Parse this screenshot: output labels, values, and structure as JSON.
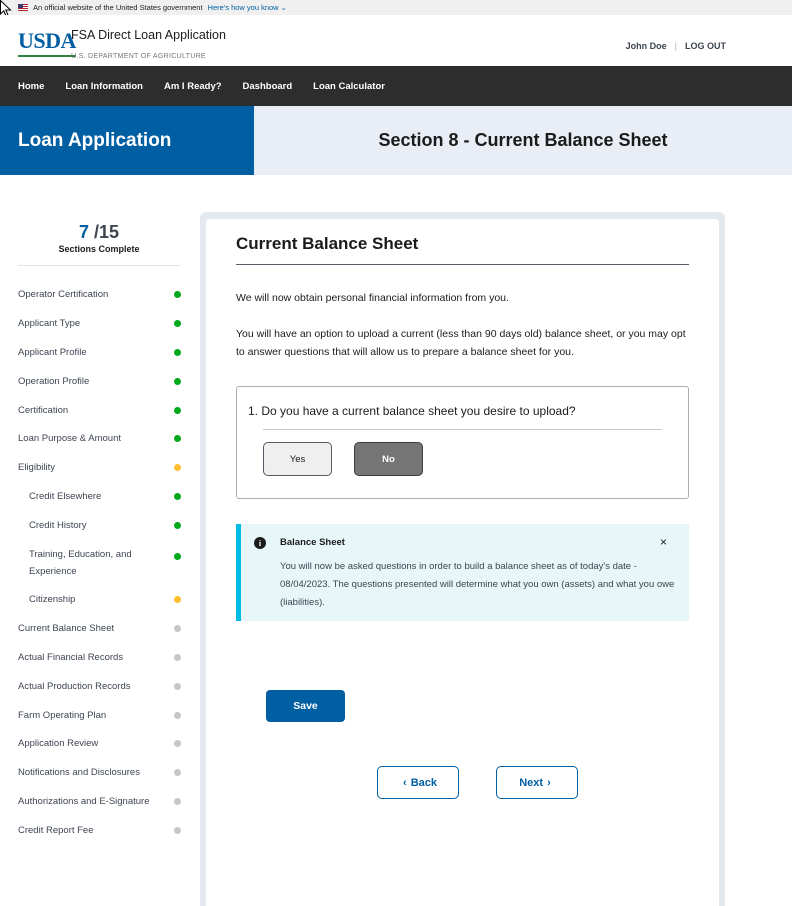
{
  "gov_banner": {
    "text": "An official website of the United States government",
    "link": "Here's how you know ⌄"
  },
  "header": {
    "logo": "USDA",
    "app_title": "FSA Direct Loan Application",
    "department": "U.S. DEPARTMENT OF AGRICULTURE",
    "user_name": "John Doe",
    "separator": "|",
    "logout": "LOG OUT"
  },
  "nav": [
    "Home",
    "Loan Information",
    "Am I Ready?",
    "Dashboard",
    "Loan Calculator"
  ],
  "hero": {
    "left_title": "Loan Application",
    "section_title": "Section 8 - Current Balance Sheet"
  },
  "progress": {
    "completed": "7",
    "total": "/15",
    "label": "Sections Complete"
  },
  "sidebar": {
    "items": [
      {
        "label": "Operator Certification",
        "status": "complete"
      },
      {
        "label": "Applicant Type",
        "status": "complete"
      },
      {
        "label": "Applicant Profile",
        "status": "complete"
      },
      {
        "label": "Operation Profile",
        "status": "complete"
      },
      {
        "label": "Certification",
        "status": "complete"
      },
      {
        "label": "Loan Purpose & Amount",
        "status": "complete"
      },
      {
        "label": "Eligibility",
        "status": "in-progress"
      },
      {
        "label": "Credit Elsewhere",
        "status": "complete"
      },
      {
        "label": "Credit History",
        "status": "complete"
      },
      {
        "label": "Training, Education, and Experience",
        "status": "complete"
      },
      {
        "label": "Citizenship",
        "status": "in-progress"
      },
      {
        "label": "Current Balance Sheet",
        "status": "not-started"
      },
      {
        "label": "Actual Financial Records",
        "status": "not-started"
      },
      {
        "label": "Actual Production Records",
        "status": "not-started"
      },
      {
        "label": "Farm Operating Plan",
        "status": "not-started"
      },
      {
        "label": "Application Review",
        "status": "not-started"
      },
      {
        "label": "Notifications and Disclosures",
        "status": "not-started"
      },
      {
        "label": "Authorizations and E-Signature",
        "status": "not-started"
      },
      {
        "label": "Credit Report Fee",
        "status": "not-started"
      }
    ]
  },
  "main": {
    "title": "Current Balance Sheet",
    "intro": "We will now obtain personal financial information from you.",
    "description": "You will have an option to upload a current (less than 90 days old) balance sheet, or you may opt to answer questions that will allow us to prepare a balance sheet for you.",
    "question": {
      "text": "1.  Do you have a current balance sheet you desire to upload?",
      "yes_label": "Yes",
      "no_label": "No",
      "selected": "No"
    },
    "alert": {
      "icon": "i",
      "title": "Balance Sheet",
      "close": "×",
      "body": "You will now be asked questions in order to build a balance sheet as of today's date - 08/04/2023. The questions presented will determine what you own (assets) and what you owe (liabilities)."
    },
    "save_label": "Save",
    "back_label": "Back",
    "next_label": "Next",
    "back_chevron": "‹",
    "next_chevron": "›"
  },
  "colors": {
    "primary": "#005ea2",
    "nav_bg": "#2d2d2d",
    "complete": "#00a91c",
    "in_progress": "#ffbe2e",
    "not_started": "#c6c6c6",
    "alert_border": "#00bde3",
    "alert_bg": "#e7f6f8"
  }
}
